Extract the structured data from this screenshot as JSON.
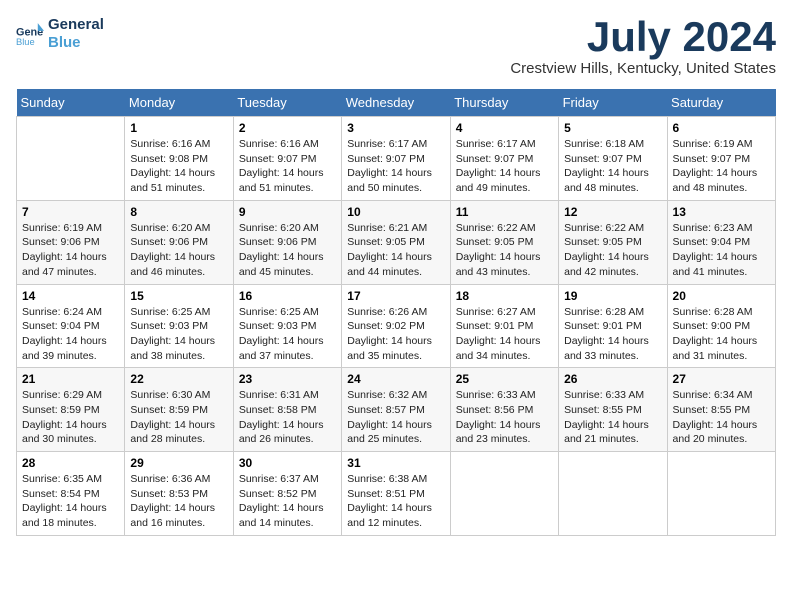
{
  "header": {
    "logo_line1": "General",
    "logo_line2": "Blue",
    "title": "July 2024",
    "subtitle": "Crestview Hills, Kentucky, United States"
  },
  "days_of_week": [
    "Sunday",
    "Monday",
    "Tuesday",
    "Wednesday",
    "Thursday",
    "Friday",
    "Saturday"
  ],
  "weeks": [
    [
      {
        "day": "",
        "sunrise": "",
        "sunset": "",
        "daylight": ""
      },
      {
        "day": "1",
        "sunrise": "Sunrise: 6:16 AM",
        "sunset": "Sunset: 9:08 PM",
        "daylight": "Daylight: 14 hours and 51 minutes."
      },
      {
        "day": "2",
        "sunrise": "Sunrise: 6:16 AM",
        "sunset": "Sunset: 9:07 PM",
        "daylight": "Daylight: 14 hours and 51 minutes."
      },
      {
        "day": "3",
        "sunrise": "Sunrise: 6:17 AM",
        "sunset": "Sunset: 9:07 PM",
        "daylight": "Daylight: 14 hours and 50 minutes."
      },
      {
        "day": "4",
        "sunrise": "Sunrise: 6:17 AM",
        "sunset": "Sunset: 9:07 PM",
        "daylight": "Daylight: 14 hours and 49 minutes."
      },
      {
        "day": "5",
        "sunrise": "Sunrise: 6:18 AM",
        "sunset": "Sunset: 9:07 PM",
        "daylight": "Daylight: 14 hours and 48 minutes."
      },
      {
        "day": "6",
        "sunrise": "Sunrise: 6:19 AM",
        "sunset": "Sunset: 9:07 PM",
        "daylight": "Daylight: 14 hours and 48 minutes."
      }
    ],
    [
      {
        "day": "7",
        "sunrise": "Sunrise: 6:19 AM",
        "sunset": "Sunset: 9:06 PM",
        "daylight": "Daylight: 14 hours and 47 minutes."
      },
      {
        "day": "8",
        "sunrise": "Sunrise: 6:20 AM",
        "sunset": "Sunset: 9:06 PM",
        "daylight": "Daylight: 14 hours and 46 minutes."
      },
      {
        "day": "9",
        "sunrise": "Sunrise: 6:20 AM",
        "sunset": "Sunset: 9:06 PM",
        "daylight": "Daylight: 14 hours and 45 minutes."
      },
      {
        "day": "10",
        "sunrise": "Sunrise: 6:21 AM",
        "sunset": "Sunset: 9:05 PM",
        "daylight": "Daylight: 14 hours and 44 minutes."
      },
      {
        "day": "11",
        "sunrise": "Sunrise: 6:22 AM",
        "sunset": "Sunset: 9:05 PM",
        "daylight": "Daylight: 14 hours and 43 minutes."
      },
      {
        "day": "12",
        "sunrise": "Sunrise: 6:22 AM",
        "sunset": "Sunset: 9:05 PM",
        "daylight": "Daylight: 14 hours and 42 minutes."
      },
      {
        "day": "13",
        "sunrise": "Sunrise: 6:23 AM",
        "sunset": "Sunset: 9:04 PM",
        "daylight": "Daylight: 14 hours and 41 minutes."
      }
    ],
    [
      {
        "day": "14",
        "sunrise": "Sunrise: 6:24 AM",
        "sunset": "Sunset: 9:04 PM",
        "daylight": "Daylight: 14 hours and 39 minutes."
      },
      {
        "day": "15",
        "sunrise": "Sunrise: 6:25 AM",
        "sunset": "Sunset: 9:03 PM",
        "daylight": "Daylight: 14 hours and 38 minutes."
      },
      {
        "day": "16",
        "sunrise": "Sunrise: 6:25 AM",
        "sunset": "Sunset: 9:03 PM",
        "daylight": "Daylight: 14 hours and 37 minutes."
      },
      {
        "day": "17",
        "sunrise": "Sunrise: 6:26 AM",
        "sunset": "Sunset: 9:02 PM",
        "daylight": "Daylight: 14 hours and 35 minutes."
      },
      {
        "day": "18",
        "sunrise": "Sunrise: 6:27 AM",
        "sunset": "Sunset: 9:01 PM",
        "daylight": "Daylight: 14 hours and 34 minutes."
      },
      {
        "day": "19",
        "sunrise": "Sunrise: 6:28 AM",
        "sunset": "Sunset: 9:01 PM",
        "daylight": "Daylight: 14 hours and 33 minutes."
      },
      {
        "day": "20",
        "sunrise": "Sunrise: 6:28 AM",
        "sunset": "Sunset: 9:00 PM",
        "daylight": "Daylight: 14 hours and 31 minutes."
      }
    ],
    [
      {
        "day": "21",
        "sunrise": "Sunrise: 6:29 AM",
        "sunset": "Sunset: 8:59 PM",
        "daylight": "Daylight: 14 hours and 30 minutes."
      },
      {
        "day": "22",
        "sunrise": "Sunrise: 6:30 AM",
        "sunset": "Sunset: 8:59 PM",
        "daylight": "Daylight: 14 hours and 28 minutes."
      },
      {
        "day": "23",
        "sunrise": "Sunrise: 6:31 AM",
        "sunset": "Sunset: 8:58 PM",
        "daylight": "Daylight: 14 hours and 26 minutes."
      },
      {
        "day": "24",
        "sunrise": "Sunrise: 6:32 AM",
        "sunset": "Sunset: 8:57 PM",
        "daylight": "Daylight: 14 hours and 25 minutes."
      },
      {
        "day": "25",
        "sunrise": "Sunrise: 6:33 AM",
        "sunset": "Sunset: 8:56 PM",
        "daylight": "Daylight: 14 hours and 23 minutes."
      },
      {
        "day": "26",
        "sunrise": "Sunrise: 6:33 AM",
        "sunset": "Sunset: 8:55 PM",
        "daylight": "Daylight: 14 hours and 21 minutes."
      },
      {
        "day": "27",
        "sunrise": "Sunrise: 6:34 AM",
        "sunset": "Sunset: 8:55 PM",
        "daylight": "Daylight: 14 hours and 20 minutes."
      }
    ],
    [
      {
        "day": "28",
        "sunrise": "Sunrise: 6:35 AM",
        "sunset": "Sunset: 8:54 PM",
        "daylight": "Daylight: 14 hours and 18 minutes."
      },
      {
        "day": "29",
        "sunrise": "Sunrise: 6:36 AM",
        "sunset": "Sunset: 8:53 PM",
        "daylight": "Daylight: 14 hours and 16 minutes."
      },
      {
        "day": "30",
        "sunrise": "Sunrise: 6:37 AM",
        "sunset": "Sunset: 8:52 PM",
        "daylight": "Daylight: 14 hours and 14 minutes."
      },
      {
        "day": "31",
        "sunrise": "Sunrise: 6:38 AM",
        "sunset": "Sunset: 8:51 PM",
        "daylight": "Daylight: 14 hours and 12 minutes."
      },
      {
        "day": "",
        "sunrise": "",
        "sunset": "",
        "daylight": ""
      },
      {
        "day": "",
        "sunrise": "",
        "sunset": "",
        "daylight": ""
      },
      {
        "day": "",
        "sunrise": "",
        "sunset": "",
        "daylight": ""
      }
    ]
  ]
}
